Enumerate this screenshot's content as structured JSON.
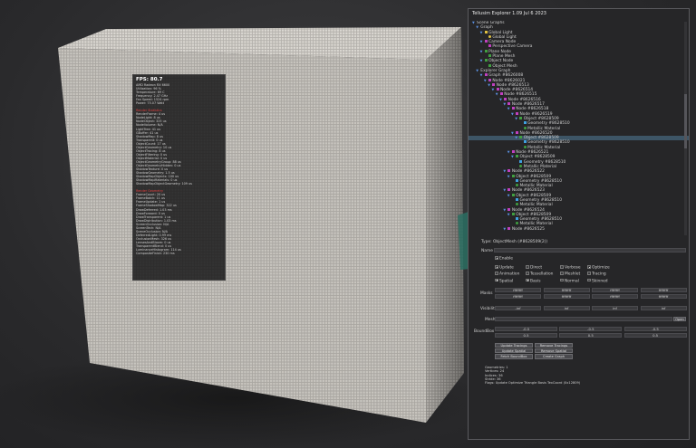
{
  "hud": {
    "fps": "FPS: 80.7",
    "gpu": [
      "AMD Radeon RX 6600",
      "Utilization: 96 %",
      "Temperature: 69 C",
      "Frequency: 2.47 GHz",
      "Fan Speed: 1524 rpm",
      "Power: 75.07 Watt"
    ],
    "render_header": "Render Statistics",
    "render": [
      "RenderFrame: 4 us",
      "NodeLight: 8 us",
      "NodeObject: 325 us",
      "NodeVolume: N/A",
      "LightTree: 41 us",
      "GBuffer: 41 us",
      "ShadowMap: 8 us",
      "Transparent: 0 us",
      "ObjectCount: 17 us",
      "ObjectGeometry: 10 us",
      "ObjectTracing: 8 us",
      "ObjectFiltering: 0 us",
      "ObjectMaterial: 0 us",
      "ObjectGeometryGroup: 88 us",
      "ObjectGeometryHidden: 0 us",
      "ShadowTexture: 0 us",
      "ShadowGeometry: 1.5 us",
      "ShadowMapObjects: 100 us",
      "ShadowMapMaterials: 0 us",
      "ShadowMapObjectGeometry: 109 us"
    ],
    "scene_header": "Render Geometry",
    "scene": [
      "FrameCount: 20 us",
      "FrameBatch: 11 us",
      "FrameUpdate: 1 us",
      "FrameShadowMap: 322 us",
      "DrawDeferred: 1.03 ms",
      "DrawForward: 0 us",
      "DrawTransparent: 1 us",
      "DrawDistribution: 1.03 ms",
      "ScreenOcclusion: N/A",
      "ScreenTech: N/A",
      "SceneOcclusion: N/A",
      "DeferredLight: 0.99 ms",
      "OcclusionMesh: 326 us",
      "LensesAndBloom: 0 us",
      "TransparentBlend: 0 us",
      "LuminanceHistogram: 114 us",
      "CompositeFinish: 230 ms"
    ]
  },
  "panel": {
    "title": "Tellusim Explorer 1.09 Jul 6 2023",
    "tree": [
      {
        "label": "Scene Graphs",
        "depth": 0,
        "icon": "arrow-down",
        "color": ""
      },
      {
        "label": "Graph",
        "depth": 1,
        "icon": "arrow-down",
        "color": ""
      },
      {
        "label": "Global Light",
        "depth": 2,
        "icon": "arrow-down",
        "color": "#e0c040"
      },
      {
        "label": "Global Light",
        "depth": 3,
        "icon": "light-icon",
        "color": "#e0c040"
      },
      {
        "label": "Camera Node",
        "depth": 2,
        "icon": "arrow-down",
        "color": "#c040c0"
      },
      {
        "label": "Perspective Camera",
        "depth": 3,
        "icon": "camera-icon",
        "color": "#c040c0"
      },
      {
        "label": "Plane Node",
        "depth": 2,
        "icon": "arrow-down",
        "color": "#40a040"
      },
      {
        "label": "Plane Mesh",
        "depth": 3,
        "icon": "mesh-icon",
        "color": "#40a040"
      },
      {
        "label": "Object Node",
        "depth": 2,
        "icon": "arrow-down",
        "color": "#40a040"
      },
      {
        "label": "Object Mesh",
        "depth": 3,
        "icon": "mesh-icon",
        "color": "#40a040"
      },
      {
        "label": "Explorer Graph",
        "depth": 1,
        "icon": "arrow-down",
        "color": ""
      },
      {
        "label": "Graph #8626008",
        "depth": 2,
        "icon": "arrow-down",
        "color": "#c040c0"
      },
      {
        "label": "Node #8626021",
        "depth": 3,
        "icon": "arrow-down",
        "color": "#c040c0"
      },
      {
        "label": "Node #8626513",
        "depth": 4,
        "icon": "arrow-down",
        "color": "#c040c0"
      },
      {
        "label": "Node #8626514",
        "depth": 5,
        "icon": "arrow-down",
        "color": "#c040c0"
      },
      {
        "label": "Node #8626515",
        "depth": 6,
        "icon": "arrow-down",
        "color": "#c040c0"
      },
      {
        "label": "Node #8626516",
        "depth": 7,
        "icon": "arrow-down",
        "color": "#c040c0"
      },
      {
        "label": "Node #8626517",
        "depth": 8,
        "icon": "arrow-down",
        "color": "#c040c0"
      },
      {
        "label": "Node #8626518",
        "depth": 9,
        "icon": "arrow-down",
        "color": "#c040c0"
      },
      {
        "label": "Node #8626519",
        "depth": 10,
        "icon": "arrow-down",
        "color": "#c040c0"
      },
      {
        "label": "Object #8628509",
        "depth": 11,
        "icon": "arrow-down",
        "color": "#40a040"
      },
      {
        "label": "Geometry #8628510",
        "depth": 12,
        "icon": "mesh-icon",
        "color": "#40a0e0"
      },
      {
        "label": "Metallic Material",
        "depth": 12,
        "icon": "material-icon",
        "color": "#40a040"
      },
      {
        "label": "Node #8626520",
        "depth": 10,
        "icon": "arrow-down",
        "color": "#c040c0"
      },
      {
        "label": "Object #8628509",
        "depth": 11,
        "icon": "arrow-down",
        "color": "#40a040",
        "selected": true
      },
      {
        "label": "Geometry #8628510",
        "depth": 12,
        "icon": "mesh-icon",
        "color": "#40a0e0"
      },
      {
        "label": "Metallic Material",
        "depth": 12,
        "icon": "material-icon",
        "color": "#40a040"
      },
      {
        "label": "Node #8626521",
        "depth": 9,
        "icon": "arrow-down",
        "color": "#c040c0"
      },
      {
        "label": "Object #8628509",
        "depth": 10,
        "icon": "arrow-down",
        "color": "#40a040"
      },
      {
        "label": "Geometry #8628510",
        "depth": 11,
        "icon": "mesh-icon",
        "color": "#40a0e0"
      },
      {
        "label": "Metallic Material",
        "depth": 11,
        "icon": "material-icon",
        "color": "#40a040"
      },
      {
        "label": "Node #8626522",
        "depth": 8,
        "icon": "arrow-down",
        "color": "#c040c0"
      },
      {
        "label": "Object #8628509",
        "depth": 9,
        "icon": "arrow-down",
        "color": "#40a040"
      },
      {
        "label": "Geometry #8628510",
        "depth": 10,
        "icon": "mesh-icon",
        "color": "#40a0e0"
      },
      {
        "label": "Metallic Material",
        "depth": 10,
        "icon": "material-icon",
        "color": "#40a040"
      },
      {
        "label": "Node #8626523",
        "depth": 8,
        "icon": "arrow-down",
        "color": "#c040c0"
      },
      {
        "label": "Object #8628509",
        "depth": 9,
        "icon": "arrow-down",
        "color": "#40a040"
      },
      {
        "label": "Geometry #8628510",
        "depth": 10,
        "icon": "mesh-icon",
        "color": "#40a0e0"
      },
      {
        "label": "Metallic Material",
        "depth": 10,
        "icon": "material-icon",
        "color": "#40a040"
      },
      {
        "label": "Node #8626524",
        "depth": 8,
        "icon": "arrow-down",
        "color": "#c040c0"
      },
      {
        "label": "Object #8628509",
        "depth": 9,
        "icon": "arrow-down",
        "color": "#40a040"
      },
      {
        "label": "Geometry #8628510",
        "depth": 10,
        "icon": "mesh-icon",
        "color": "#40a0e0"
      },
      {
        "label": "Metallic Material",
        "depth": 10,
        "icon": "material-icon",
        "color": "#40a040"
      },
      {
        "label": "Node #8626525",
        "depth": 8,
        "icon": "arrow-down",
        "color": "#c040c0"
      }
    ],
    "type_label": "Type: ObjectMesh (#8628509(2))",
    "name_label": "Name",
    "name_value": "",
    "enable": {
      "label": "Enable",
      "checked": true
    },
    "flags": [
      {
        "label": "Update",
        "checked": true
      },
      {
        "label": "Direct",
        "checked": false
      },
      {
        "label": "Verbose",
        "checked": false
      },
      {
        "label": "Optimize",
        "checked": true
      },
      {
        "label": "Animation",
        "checked": false
      },
      {
        "label": "Tessellation",
        "checked": false
      },
      {
        "label": "Meshlet",
        "checked": false
      },
      {
        "label": "Tracing",
        "checked": false
      },
      {
        "label": "Spatial",
        "checked": true
      },
      {
        "label": "Basis",
        "checked": true
      },
      {
        "label": "Normal",
        "checked": false
      },
      {
        "label": "Skinned",
        "checked": false
      }
    ],
    "masks_label": "Masks",
    "masks": [
      "ffffffff",
      "ffffffff",
      "ffffffff",
      "ffffffff",
      "ffffffff",
      "ffffffff",
      "ffffffff",
      "ffffffff"
    ],
    "visibility_label": "Visibility",
    "visibility": [
      "-inf",
      "inf",
      "inf",
      "inf"
    ],
    "mesh_label": "Mesh",
    "mesh_value": "",
    "open_label": "Open",
    "boundbox_label": "BoundBox",
    "boundbox": [
      "-0.5",
      "-0.5",
      "-0.5",
      "0.5",
      "0.5",
      "0.5"
    ],
    "buttons": [
      "Update Tracings",
      "Remove Tracings",
      "Update Spatial",
      "Remove Spatial",
      "Fetch BoundBox",
      "Create Graph"
    ],
    "info": [
      "Geometries: 1",
      "Vertices: 24",
      "Indices: 36",
      "Stride: 36",
      "Flags: Update Optimize Triangle Basis TexCoord (0x12809)"
    ]
  }
}
